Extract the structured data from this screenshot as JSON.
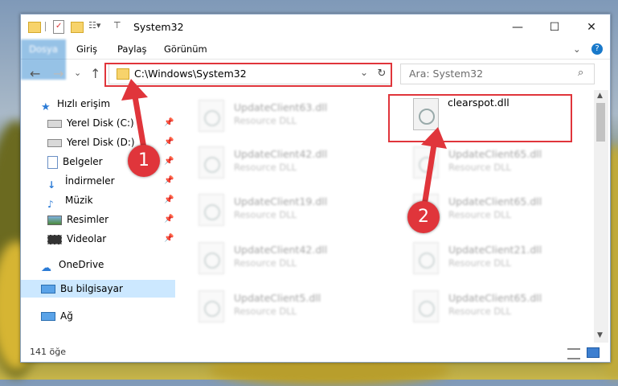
{
  "window": {
    "title": "System32",
    "controls": {
      "minimize": "—",
      "maximize": "☐",
      "close": "✕"
    }
  },
  "ribbon": {
    "tabs": [
      "Dosya",
      "Giriş",
      "Paylaş",
      "Görünüm"
    ],
    "collapse": "⌄",
    "help": "?"
  },
  "address": {
    "path": "C:\\Windows\\System32",
    "dropdown": "⌄",
    "refresh": "↻"
  },
  "search": {
    "placeholder": "Ara: System32",
    "icon": "⌕"
  },
  "nav": {
    "back": "←",
    "forward": "→",
    "recent": "⌄",
    "up": "↑"
  },
  "sidebar": {
    "quick_access": "Hızlı erişim",
    "items": [
      "Yerel Disk (C:)",
      "Yerel Disk (D:)",
      "Belgeler",
      "İndirmeler",
      "Müzik",
      "Resimler",
      "Videolar"
    ],
    "pin": "📌",
    "onedrive": "OneDrive",
    "this_pc": "Bu bilgisayar",
    "network": "Ağ"
  },
  "files": {
    "left": [
      {
        "name": "UpdateClient63.dll",
        "desc": "Resource DLL"
      },
      {
        "name": "UpdateClient42.dll",
        "desc": "Resource DLL"
      },
      {
        "name": "UpdateClient19.dll",
        "desc": "Resource DLL"
      },
      {
        "name": "UpdateClient42.dll",
        "desc": "Resource DLL"
      },
      {
        "name": "UpdateClient5.dll",
        "desc": "Resource DLL"
      }
    ],
    "right": [
      {
        "name": "clearspot.dll",
        "desc": ""
      },
      {
        "name": "UpdateClient65.dll",
        "desc": "Resource DLL"
      },
      {
        "name": "UpdateClient65.dll",
        "desc": "Resource DLL"
      },
      {
        "name": "UpdateClient21.dll",
        "desc": "Resource DLL"
      },
      {
        "name": "UpdateClient65.dll",
        "desc": "Resource DLL"
      }
    ]
  },
  "status": {
    "count": "141 öğe"
  },
  "annotations": {
    "step1": "1",
    "step2": "2",
    "color": "#e0353b"
  }
}
